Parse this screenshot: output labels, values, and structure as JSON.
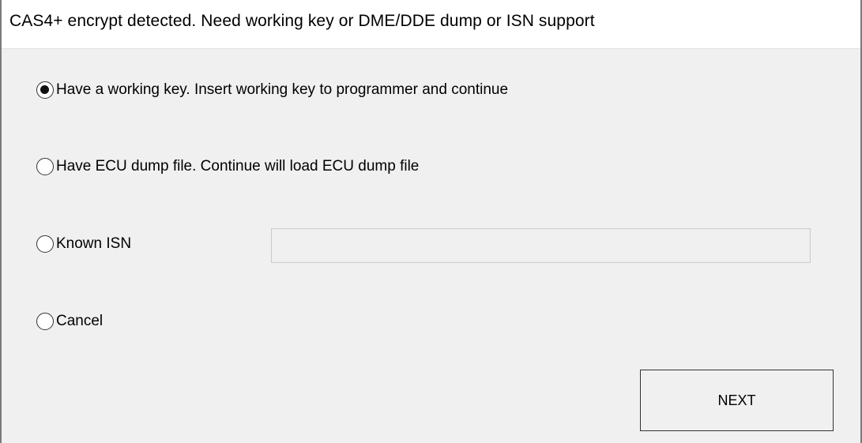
{
  "dialog": {
    "title": "CAS4+ encrypt detected. Need working key or DME/DDE dump or ISN support"
  },
  "options": [
    {
      "label": "Have a working key. Insert working key to programmer and continue",
      "checked": true
    },
    {
      "label": "Have ECU dump file. Continue will load ECU dump file",
      "checked": false
    },
    {
      "label": "Known ISN",
      "checked": false
    },
    {
      "label": "Cancel",
      "checked": false
    }
  ],
  "isn_field": {
    "value": "",
    "placeholder": ""
  },
  "buttons": {
    "next_label": "NEXT"
  }
}
